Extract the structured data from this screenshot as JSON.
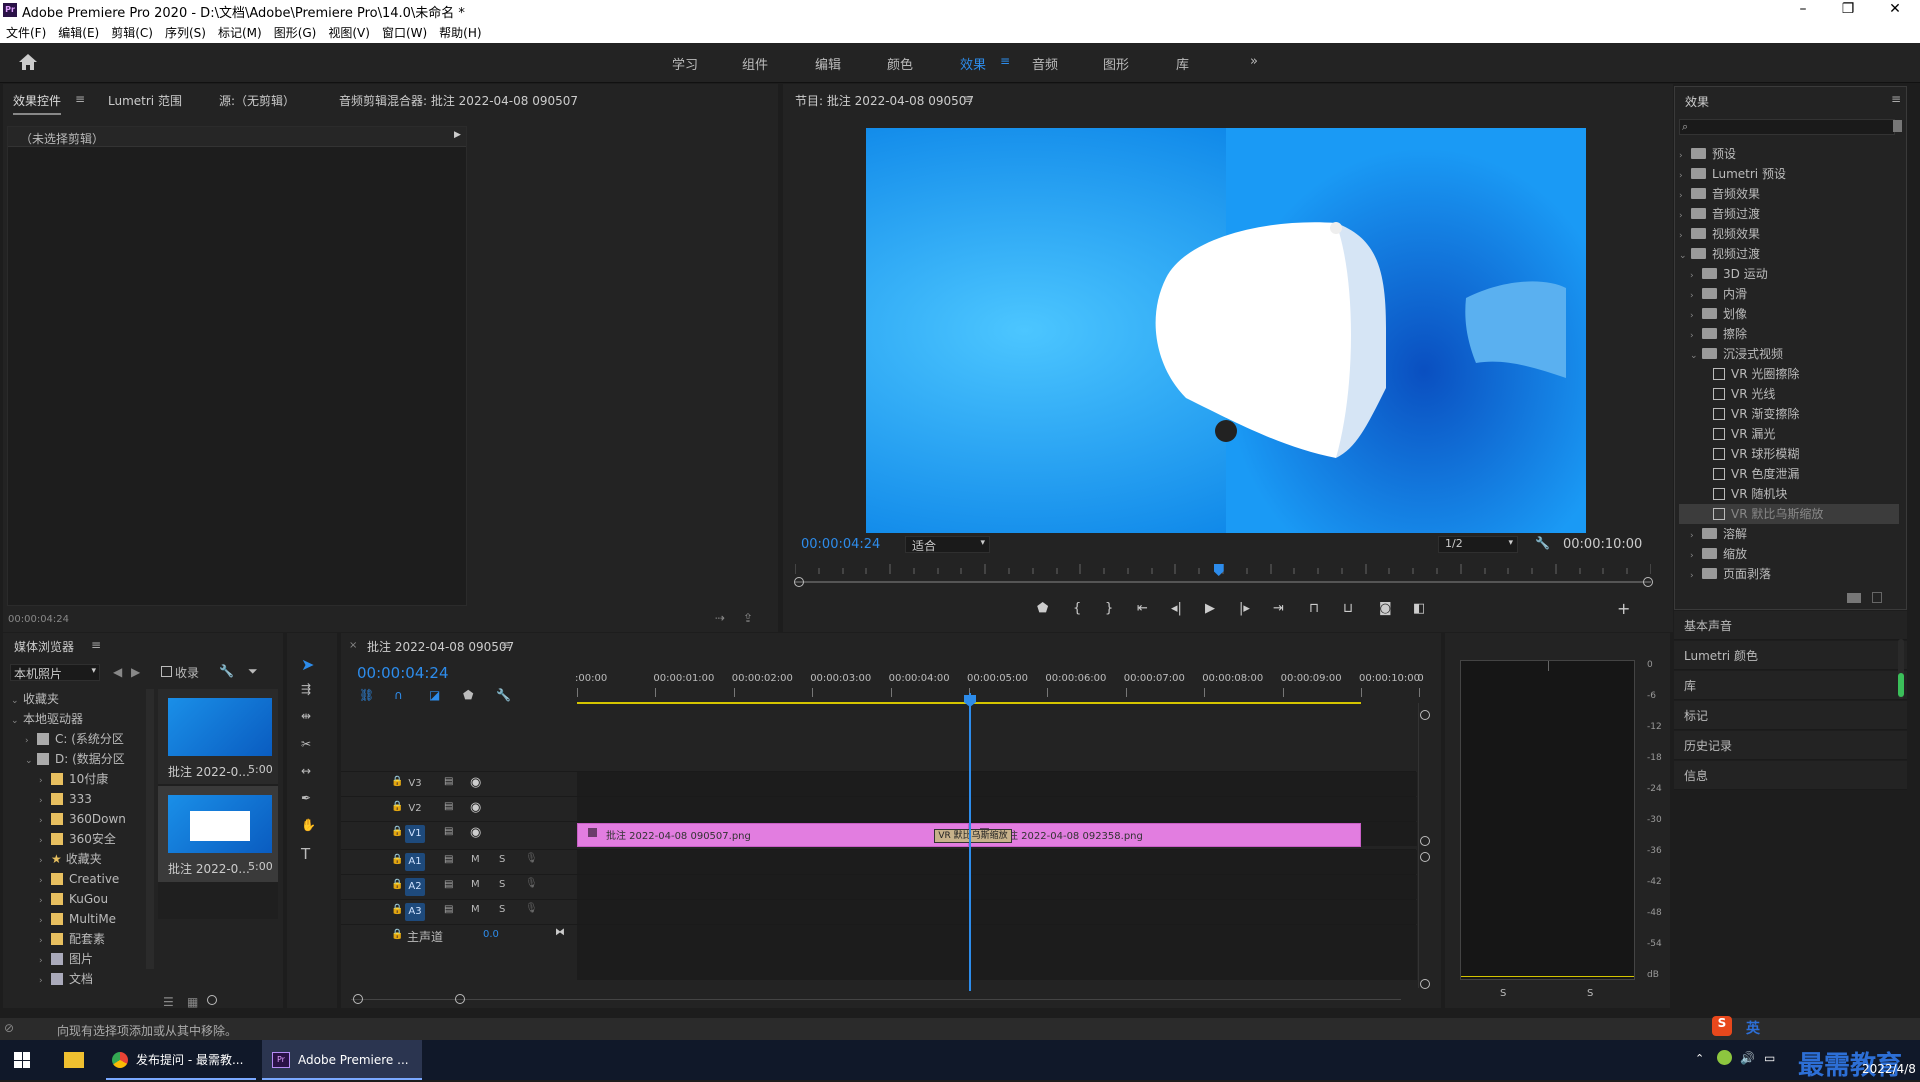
{
  "window": {
    "title": "Adobe Premiere Pro 2020 - D:\\文档\\Adobe\\Premiere Pro\\14.0\\未命名 *",
    "minimize": "–",
    "maximize": "❐",
    "close": "✕"
  },
  "menu": [
    "文件(F)",
    "编辑(E)",
    "剪辑(C)",
    "序列(S)",
    "标记(M)",
    "图形(G)",
    "视图(V)",
    "窗口(W)",
    "帮助(H)"
  ],
  "workspaces": {
    "items": [
      "学习",
      "组件",
      "编辑",
      "颜色",
      "效果",
      "音频",
      "图形",
      "库"
    ],
    "active": "效果",
    "more": "»"
  },
  "source_panel": {
    "tabs": [
      "效果控件",
      "Lumetri 范围",
      "源:（无剪辑）",
      "音频剪辑混合器: 批注 2022-04-08 090507"
    ],
    "no_clip": "（未选择剪辑）",
    "timecode": "00:00:04:24"
  },
  "program": {
    "title": "节目: 批注 2022-04-08 090507",
    "timecode": "00:00:04:24",
    "fit": "适合",
    "quality": "1/2",
    "duration": "00:00:10:00",
    "playhead": 0.495
  },
  "effects": {
    "title": "效果",
    "search_placeholder": "",
    "items": [
      {
        "label": "预设",
        "level": 0,
        "type": "folder",
        "open": false
      },
      {
        "label": "Lumetri 预设",
        "level": 0,
        "type": "folder",
        "open": false
      },
      {
        "label": "音频效果",
        "level": 0,
        "type": "folder",
        "open": false
      },
      {
        "label": "音频过渡",
        "level": 0,
        "type": "folder",
        "open": false
      },
      {
        "label": "视频效果",
        "level": 0,
        "type": "folder",
        "open": false
      },
      {
        "label": "视频过渡",
        "level": 0,
        "type": "folder",
        "open": true
      },
      {
        "label": "3D 运动",
        "level": 1,
        "type": "folder",
        "open": false
      },
      {
        "label": "内滑",
        "level": 1,
        "type": "folder",
        "open": false
      },
      {
        "label": "划像",
        "level": 1,
        "type": "folder",
        "open": false
      },
      {
        "label": "擦除",
        "level": 1,
        "type": "folder",
        "open": false
      },
      {
        "label": "沉浸式视频",
        "level": 1,
        "type": "folder",
        "open": true
      },
      {
        "label": "VR 光圈擦除",
        "level": 2,
        "type": "effect"
      },
      {
        "label": "VR 光线",
        "level": 2,
        "type": "effect"
      },
      {
        "label": "VR 渐变擦除",
        "level": 2,
        "type": "effect"
      },
      {
        "label": "VR 漏光",
        "level": 2,
        "type": "effect"
      },
      {
        "label": "VR 球形模糊",
        "level": 2,
        "type": "effect"
      },
      {
        "label": "VR 色度泄漏",
        "level": 2,
        "type": "effect"
      },
      {
        "label": "VR 随机块",
        "level": 2,
        "type": "effect"
      },
      {
        "label": "VR 默比乌斯缩放",
        "level": 2,
        "type": "effect",
        "selected": true
      },
      {
        "label": "溶解",
        "level": 1,
        "type": "folder",
        "open": false
      },
      {
        "label": "缩放",
        "level": 1,
        "type": "folder",
        "open": false
      },
      {
        "label": "页面剥落",
        "level": 1,
        "type": "folder",
        "open": false
      }
    ]
  },
  "side_panels": [
    "基本声音",
    "Lumetri 颜色",
    "库",
    "标记",
    "历史记录",
    "信息"
  ],
  "media": {
    "title": "媒体浏览器",
    "location": "本机照片",
    "favorites_check": "收录",
    "tree": [
      {
        "label": "收藏夹",
        "level": 0,
        "icon": "none"
      },
      {
        "label": "本地驱动器",
        "level": 0,
        "icon": "none"
      },
      {
        "label": "C: (系统分区",
        "level": 1,
        "icon": "drive"
      },
      {
        "label": "D: (数据分区",
        "level": 1,
        "icon": "drive"
      },
      {
        "label": "10付康",
        "level": 2,
        "icon": "folder"
      },
      {
        "label": "333",
        "level": 2,
        "icon": "folder"
      },
      {
        "label": "360Down",
        "level": 2,
        "icon": "folder"
      },
      {
        "label": "360安全",
        "level": 2,
        "icon": "folder"
      },
      {
        "label": "收藏夹",
        "level": 2,
        "icon": "star"
      },
      {
        "label": "Creative",
        "level": 2,
        "icon": "folder"
      },
      {
        "label": "KuGou",
        "level": 2,
        "icon": "folder"
      },
      {
        "label": "MultiMe",
        "level": 2,
        "icon": "folder"
      },
      {
        "label": "配套素",
        "level": 2,
        "icon": "folder"
      },
      {
        "label": "图片",
        "level": 2,
        "icon": "picture"
      },
      {
        "label": "文档",
        "level": 2,
        "icon": "doc"
      }
    ],
    "thumbs": [
      {
        "name": "批注 2022-0...",
        "dur": "5:00"
      },
      {
        "name": "批注 2022-0...",
        "dur": "5:00"
      }
    ]
  },
  "timeline": {
    "title": "批注 2022-04-08 090507",
    "timecode": "00:00:04:24",
    "ruler": [
      ":00:00",
      "00:00:01:00",
      "00:00:02:00",
      "00:00:03:00",
      "00:00:04:00",
      "00:00:05:00",
      "00:00:06:00",
      "00:00:07:00",
      "00:00:08:00",
      "00:00:09:00",
      "00:00:10:00",
      "0"
    ],
    "video_tracks": [
      "V3",
      "V2",
      "V1"
    ],
    "audio_tracks": [
      "A1",
      "A2",
      "A3"
    ],
    "mute": "M",
    "solo": "S",
    "master": {
      "label": "主声道",
      "value": "0.0"
    },
    "clips": [
      {
        "label": "批注 2022-04-08 090507.png",
        "start": 0,
        "end": 5
      },
      {
        "label": "批注 2022-04-08 092358.png",
        "start": 5,
        "end": 10
      }
    ],
    "transition": "VR 默比乌斯缩放",
    "playhead": 5.0
  },
  "meter": {
    "scale": [
      "0",
      "-6",
      "-12",
      "-18",
      "-24",
      "-30",
      "-36",
      "-42",
      "-48",
      "-54",
      "dB"
    ],
    "solo": [
      "S",
      "S"
    ]
  },
  "status": "向现有选择项添加或从其中移除。",
  "taskbar": {
    "items": [
      "发布提问 - 最需教...",
      "Adobe Premiere ..."
    ],
    "ime": "英",
    "watermark": "最需教育",
    "date": "2022/4/8"
  }
}
